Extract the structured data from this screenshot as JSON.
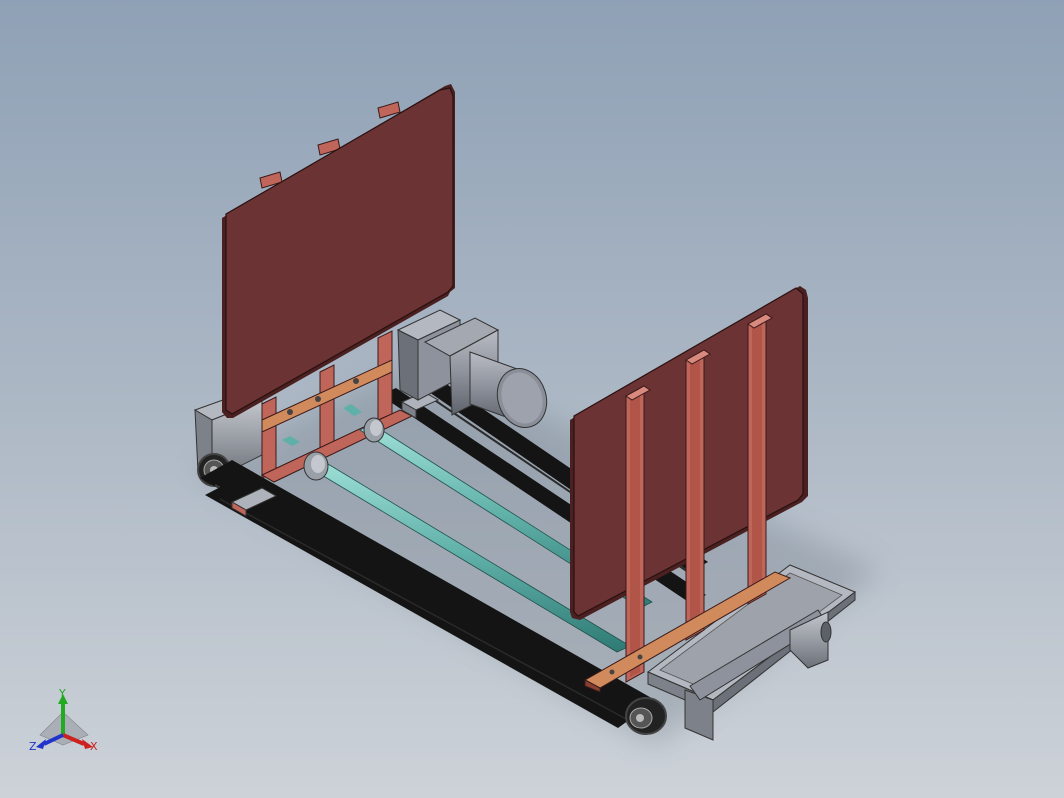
{
  "viewport": {
    "background_top": "#8fa1b6",
    "background_bottom": "#cdd2d8"
  },
  "model": {
    "panel_color": "#6b3333",
    "bracket_color": "#c0655a",
    "shaft_color": "#5fb0a8",
    "belt_color": "#141414",
    "frame_color": "#9aa0a8",
    "motor_color": "#9a9ea8"
  },
  "triad": {
    "x_label": "X",
    "y_label": "Y",
    "z_label": "Z",
    "x_color": "#cc2222",
    "y_color": "#22aa22",
    "z_color": "#2233cc"
  }
}
